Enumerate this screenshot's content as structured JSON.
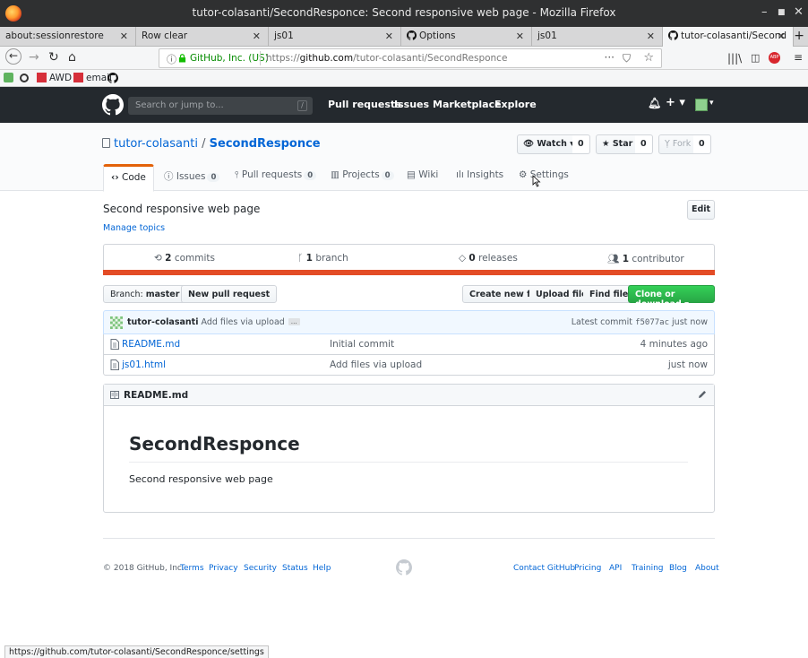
{
  "window": {
    "title": "tutor-colasanti/SecondResponce: Second responsive web page - Mozilla Firefox",
    "controls": [
      "–",
      "■",
      "✕"
    ]
  },
  "tabs": [
    {
      "label": "about:sessionrestore"
    },
    {
      "label": "Row clear"
    },
    {
      "label": "js01"
    },
    {
      "label": "Options"
    },
    {
      "label": "js01"
    },
    {
      "label": "tutor-colasanti/Second"
    }
  ],
  "navbar": {
    "identity": "GitHub, Inc. (US)",
    "url_prefix": "https://",
    "url_domain": "github.com",
    "url_path": "/tutor-colasanti/SecondResponce"
  },
  "bookmarks": [
    {
      "label": "AWD",
      "color": "#d62f3a"
    },
    {
      "label": "email",
      "color": "#d62f3a"
    }
  ],
  "github": {
    "search_placeholder": "Search or jump to...",
    "search_key": "/",
    "nav": [
      "Pull requests",
      "Issues",
      "Marketplace",
      "Explore"
    ],
    "plus": "+ ▾",
    "avatar_caret": "▾"
  },
  "repo": {
    "owner": "tutor-colasanti",
    "separator": "/",
    "name": "SecondResponce",
    "watch_label": "Watch ▾",
    "watch_count": "0",
    "star_label": "Star",
    "star_count": "0",
    "fork_label": "Fork",
    "fork_count": "0",
    "tabs": [
      {
        "label": "Code",
        "count": ""
      },
      {
        "label": "Issues",
        "count": "0"
      },
      {
        "label": "Pull requests",
        "count": "0"
      },
      {
        "label": "Projects",
        "count": "0"
      },
      {
        "label": "Wiki",
        "count": ""
      },
      {
        "label": "Insights",
        "count": ""
      },
      {
        "label": "Settings",
        "count": ""
      }
    ],
    "description": "Second responsive web page",
    "manage_topics": "Manage topics",
    "edit_label": "Edit",
    "summary": {
      "commits_num": "2",
      "commits_label": "commits",
      "branch_num": "1",
      "branch_label": "branch",
      "releases_num": "0",
      "releases_label": "releases",
      "contrib_num": "1",
      "contrib_label": "contributor"
    },
    "language_color": "#e34c26",
    "branch_prefix": "Branch:",
    "branch_name": "master ▾",
    "new_pr": "New pull request",
    "create_file": "Create new file",
    "upload_files": "Upload files",
    "find_file": "Find file",
    "clone": "Clone or download ▾",
    "commit": {
      "author": "tutor-colasanti",
      "message": "Add files via upload",
      "ellipsis": "…",
      "latest_label": "Latest commit",
      "sha": "f5077ac",
      "when": "just now"
    },
    "files": [
      {
        "name": "README.md",
        "message": "Initial commit",
        "age": "4 minutes ago"
      },
      {
        "name": "js01.html",
        "message": "Add files via upload",
        "age": "just now"
      }
    ],
    "readme": {
      "filename": "README.md",
      "heading": "SecondResponce",
      "body": "Second responsive web page"
    }
  },
  "footer": {
    "copyright": "© 2018 GitHub, Inc.",
    "left_links": [
      "Terms",
      "Privacy",
      "Security",
      "Status",
      "Help"
    ],
    "right_links": [
      "Contact GitHub",
      "Pricing",
      "API",
      "Training",
      "Blog",
      "About"
    ]
  },
  "status_url": "https://github.com/tutor-colasanti/SecondResponce/settings"
}
